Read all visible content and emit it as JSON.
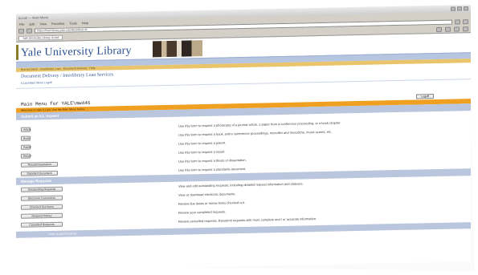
{
  "browser": {
    "title": "ILLiad — Main Menu",
    "menu": [
      "File",
      "Edit",
      "View",
      "Favorites",
      "Tools",
      "Help"
    ],
    "address": "https://illiad.library.yale.edu/illiad/illiad.dll",
    "tab": "Yale University Library ILLiad"
  },
  "header": {
    "library_name": "Yale University Library",
    "banner_link": "Yale University Library"
  },
  "nav_strip": "Borrow Direct · Interlibrary Loan · Document Delivery · Help",
  "service": {
    "heading": "Document Delivery / Interlibrary Loan Services",
    "sub_links": "ILLiad Main Menu   Logoff"
  },
  "main": {
    "title": "Main Menu for YALE\\mw446",
    "top_button": "Logoff",
    "notice": "Welcome to Yale ILLiad. Use the Main Menu below."
  },
  "sections": [
    {
      "heading": "Submit an ILL request",
      "rows": [
        {
          "button": "Article",
          "width": 12,
          "desc": "Use this form to request a photocopy of a journal article, a paper from a conference proceeding, or a book chapter."
        },
        {
          "button": "Book",
          "width": 12,
          "desc": "Use this form to request a book, entire conference proceedings, microfilm and microfiche, music scores, etc."
        },
        {
          "button": "Patent",
          "width": 12,
          "desc": "Use this form to request a patent."
        },
        {
          "button": "Report",
          "width": 12,
          "desc": "Use this form to request a report."
        },
        {
          "button": "Thesis/Dissertation",
          "width": 46,
          "desc": "Use this form to request a thesis or dissertation."
        },
        {
          "button": "Standard Document",
          "width": 46,
          "desc": "Use this form to request a standards document."
        }
      ]
    },
    {
      "heading": "Manage Requests",
      "rows": [
        {
          "button": "Outstanding Requests",
          "width": 52,
          "desc": "View and edit outstanding requests, including detailed request information and statuses."
        },
        {
          "button": "Electronic Documents",
          "width": 52,
          "desc": "View or download electronic documents."
        },
        {
          "button": "Checked Out Items",
          "width": 52,
          "desc": "Review due dates or renew items checked out."
        },
        {
          "button": "Request History",
          "width": 52,
          "desc": "Review your completed requests."
        },
        {
          "button": "Cancelled Requests",
          "width": 52,
          "desc": "Review cancelled requests. Resubmit requests with more complete and / or accurate information."
        }
      ]
    }
  ],
  "footer_heading": "Other ILLiad Functions"
}
